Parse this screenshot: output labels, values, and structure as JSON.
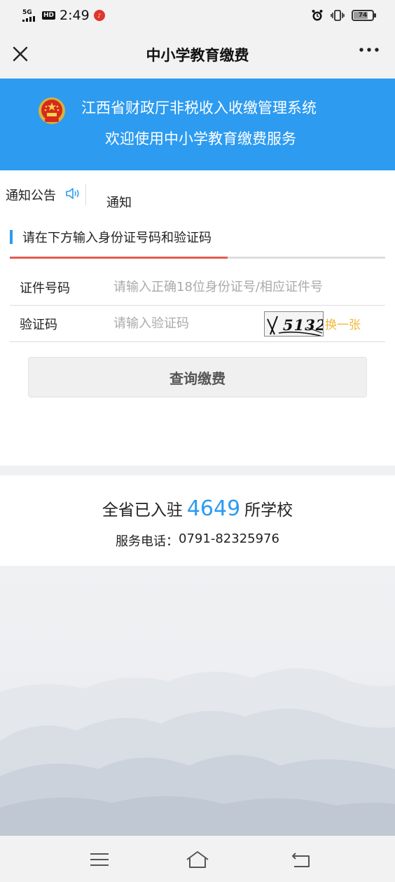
{
  "status_bar": {
    "network": "5G",
    "hd": "HD",
    "time": "2:49",
    "battery": "74"
  },
  "nav": {
    "title": "中小学教育缴费"
  },
  "banner": {
    "line1": "江西省财政厅非税收入收缴管理系统",
    "line2": "欢迎使用中小学教育缴费服务"
  },
  "notice": {
    "label": "通知公告",
    "text": "通知"
  },
  "form": {
    "section_title": "请在下方输入身份证号码和验证码",
    "progress": 0.58,
    "id_label": "证件号码",
    "id_placeholder": "请输入正确18位身份证号/相应证件号",
    "captcha_label": "验证码",
    "captcha_placeholder": "请输入验证码",
    "captcha_text": "5132",
    "refresh_label": "换一张",
    "query_button": "查询缴费"
  },
  "stats": {
    "prefix": "全省已入驻",
    "count": "4649",
    "suffix": "所学校",
    "phone_label": "服务电话：",
    "phone": "0791-82325976"
  },
  "colors": {
    "brand_blue": "#2d9bf0",
    "progress_red": "#e55b50",
    "refresh_orange": "#f0b83c"
  },
  "icons": {
    "close": "close-icon",
    "more": "more-icon",
    "speaker": "speaker-icon",
    "emblem": "national-emblem-icon",
    "menu": "menu-icon",
    "home": "home-icon",
    "back": "back-icon"
  }
}
